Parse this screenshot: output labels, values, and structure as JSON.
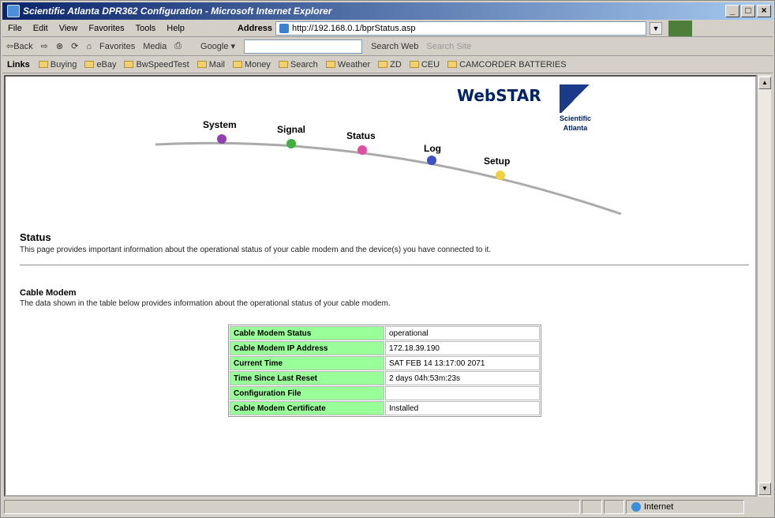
{
  "window": {
    "title": "Scientific Atlanta DPR362 Configuration - Microsoft Internet Explorer",
    "min": "_",
    "max": "□",
    "close": "×"
  },
  "menu": [
    "File",
    "Edit",
    "View",
    "Favorites",
    "Tools",
    "Help"
  ],
  "address": {
    "label": "Address",
    "url": "http://192.168.0.1/bprStatus.asp"
  },
  "toolbar": {
    "back": "⇦Back",
    "forward": "⇨",
    "favorites": "Favorites",
    "media": "Media",
    "google": "Google ▾",
    "search_web": "Search Web",
    "search_site": "Search Site"
  },
  "links": {
    "label": "Links",
    "items": [
      "Buying",
      "eBay",
      "BwSpeedTest",
      "Mail",
      "Money",
      "Search",
      "Weather",
      "ZD",
      "CEU",
      "CAMCORDER BATTERIES"
    ]
  },
  "nav": {
    "system": "System",
    "signal": "Signal",
    "status": "Status",
    "log": "Log",
    "setup": "Setup"
  },
  "logos": {
    "webstar": "WebSTAR",
    "sa_line1": "Scientific",
    "sa_line2": "Atlanta"
  },
  "status_section": {
    "title": "Status",
    "desc": "This page provides important information about the operational status of your cable modem and the device(s) you have connected to it."
  },
  "cable_section": {
    "title": "Cable Modem",
    "desc": "The data shown in the table below provides information about the operational status of your cable modem."
  },
  "table": [
    {
      "label": "Cable Modem Status",
      "value": "operational"
    },
    {
      "label": "Cable Modem IP Address",
      "value": "172.18.39.190"
    },
    {
      "label": "Current Time",
      "value": "SAT FEB 14 13:17:00 2071"
    },
    {
      "label": "Time Since Last Reset",
      "value": "2 days 04h:53m:23s"
    },
    {
      "label": "Configuration File",
      "value": ""
    },
    {
      "label": "Cable Modem Certificate",
      "value": "Installed"
    }
  ],
  "statusbar": {
    "zone": "Internet"
  },
  "colors": {
    "nav_system": "#9040b0",
    "nav_signal": "#40b040",
    "nav_status": "#e050a0",
    "nav_log": "#4050c0",
    "nav_setup": "#f0d040",
    "table_label_bg": "#99ff99"
  }
}
